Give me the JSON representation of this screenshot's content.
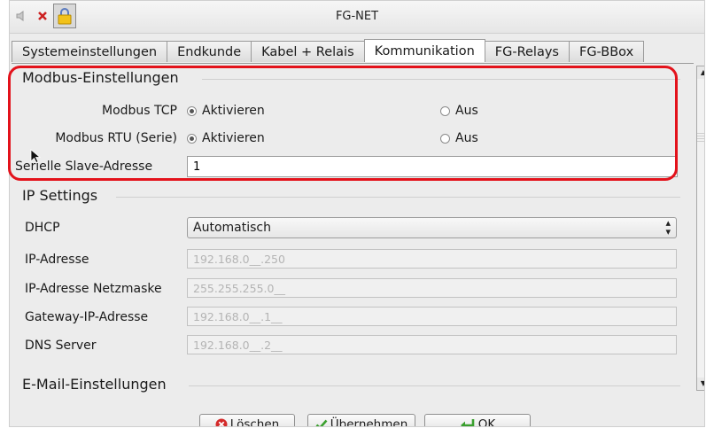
{
  "window": {
    "title": "FG-NET"
  },
  "titlebar_icons": [
    {
      "name": "speaker-icon"
    },
    {
      "name": "close-icon"
    },
    {
      "name": "lock-icon"
    }
  ],
  "tabs": [
    {
      "label": "Systemeinstellungen",
      "active": false
    },
    {
      "label": "Endkunde",
      "active": false
    },
    {
      "label": "Kabel + Relais",
      "active": false
    },
    {
      "label": "Kommunikation",
      "active": true
    },
    {
      "label": "FG-Relays",
      "active": false
    },
    {
      "label": "FG-BBox",
      "active": false
    }
  ],
  "modbus": {
    "title": "Modbus-Einstellungen",
    "tcp_label": "Modbus TCP",
    "rtu_label": "Modbus RTU (Serie)",
    "activate_label": "Aktivieren",
    "off_label": "Aus",
    "tcp_selected": "Aktivieren",
    "rtu_selected": "Aktivieren",
    "slave_label": "Serielle Slave-Adresse",
    "slave_value": "1"
  },
  "ip": {
    "title": "IP Settings",
    "dhcp_label": "DHCP",
    "dhcp_value": "Automatisch",
    "ip_label": "IP-Adresse",
    "ip_value": "192.168.0__.250",
    "mask_label": "IP-Adresse Netzmaske",
    "mask_value": "255.255.255.0__",
    "gateway_label": "Gateway-IP-Adresse",
    "gateway_value": "192.168.0__.1__",
    "dns_label": "DNS Server",
    "dns_value": "192.168.0__.2__"
  },
  "email": {
    "title": "E-Mail-Einstellungen"
  },
  "buttons": {
    "delete": "Löschen",
    "apply": "Übernehmen",
    "ok": "OK"
  },
  "colors": {
    "highlight": "#e3121b",
    "check": "#3aa02e",
    "delete": "#d42a2a"
  }
}
